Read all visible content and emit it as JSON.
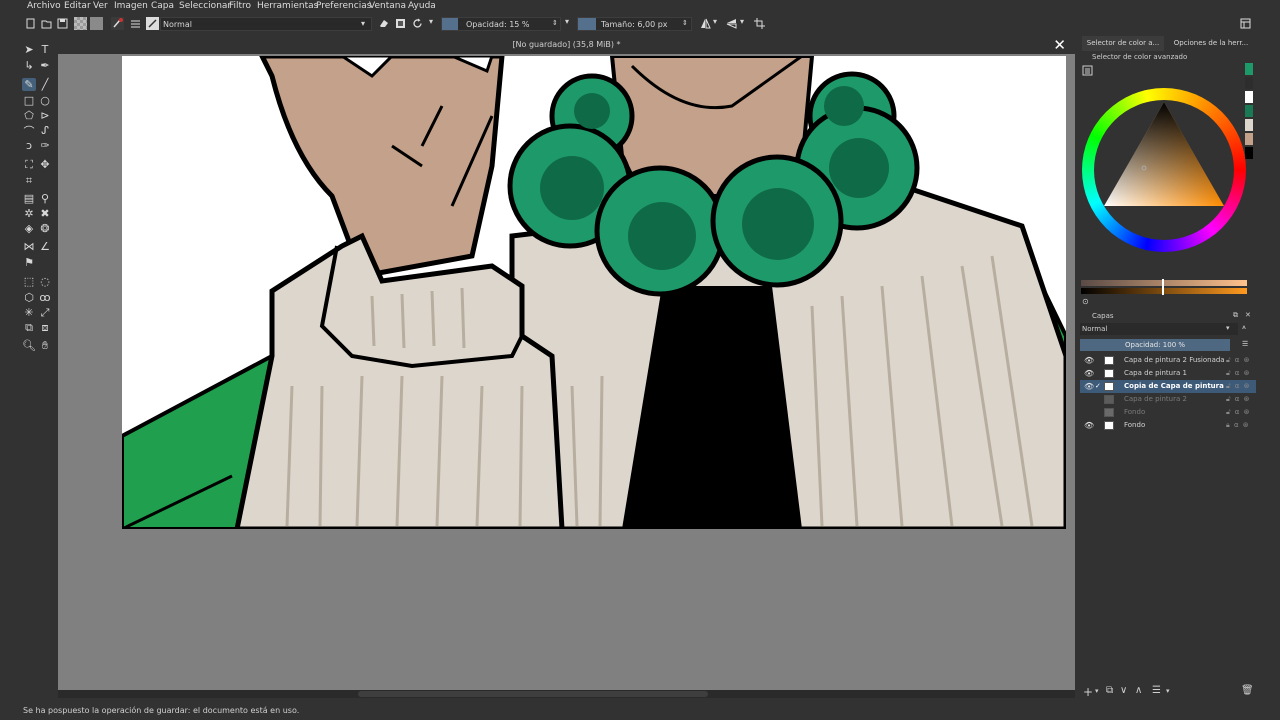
{
  "menu": [
    "Archivo",
    "Editar",
    "Ver",
    "Imagen",
    "Capa",
    "Seleccionar",
    "Filtro",
    "Herramientas",
    "Preferencias",
    "Ventana",
    "Ayuda"
  ],
  "tool_options": {
    "blend_mode": "Normal",
    "opacity_label": "Opacidad: 15 %",
    "size_label": "Tamaño: 6,00 px"
  },
  "document": {
    "title": "[No guardado]  (35,8 MiB) *",
    "close_icon": "close-icon"
  },
  "right_panel": {
    "tabs": [
      "Selector de color a...",
      "Opciones de la herr..."
    ],
    "color_panel_title": "Selector de color avanzado",
    "layers_title": "Capas",
    "layers_blend": "Normal",
    "layers_opacity": "Opacidad:  100 %",
    "layers": [
      {
        "name": "Capa de pintura 2 Fusionada",
        "visible": true,
        "selected": false,
        "dim": false
      },
      {
        "name": "Capa de pintura 1",
        "visible": true,
        "selected": false,
        "dim": false
      },
      {
        "name": "Copia de Capa de pintura ...",
        "visible": true,
        "selected": true,
        "dim": false
      },
      {
        "name": "Capa de pintura 2",
        "visible": false,
        "selected": false,
        "dim": true
      },
      {
        "name": "Fondo",
        "visible": false,
        "selected": false,
        "dim": true
      },
      {
        "name": "Fondo",
        "visible": true,
        "selected": false,
        "dim": false
      }
    ]
  },
  "status": "Se ha pospuesto la operación de guardar: el documento está en uso.",
  "colors": {
    "accent": "#44607a",
    "selected_layer": "#3d5a79",
    "canvas_bg": "#808080",
    "green_bead": "#1e9a6a",
    "green_bead_center": "#0f6a47",
    "sweater": "#ddd6cc",
    "skin": "#c4a18a"
  }
}
